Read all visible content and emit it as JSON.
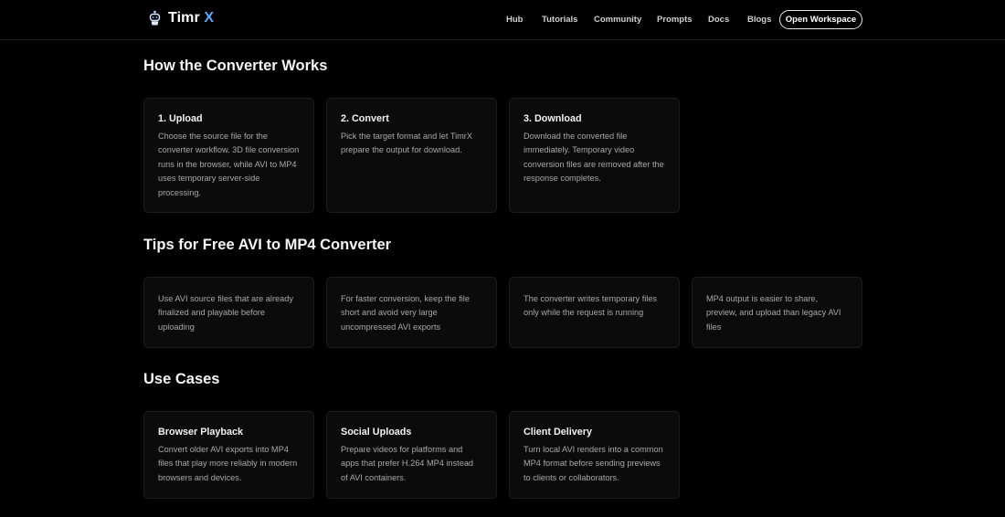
{
  "brand": {
    "name": "Timr",
    "accent": "X",
    "logo_icon": "robot-icon"
  },
  "nav": {
    "links": [
      "Hub",
      "Tutorials",
      "Community",
      "Prompts",
      "Docs",
      "Blogs"
    ],
    "cta": "Open Workspace"
  },
  "how": {
    "title": "How the Converter Works",
    "steps": [
      {
        "title": "1. Upload",
        "text": "Choose the source file for the converter workflow. 3D file conversion runs in the browser, while AVI to MP4 uses temporary server-side processing."
      },
      {
        "title": "2. Convert",
        "text": "Pick the target format and let TimrX prepare the output for download."
      },
      {
        "title": "3. Download",
        "text": "Download the converted file immediately. Temporary video conversion files are removed after the response completes."
      }
    ]
  },
  "tips": {
    "title": "Tips for Free AVI to MP4 Converter",
    "items": [
      "Use AVI source files that are already finalized and playable before uploading",
      "For faster conversion, keep the file short and avoid very large uncompressed AVI exports",
      "The converter writes temporary files only while the request is running",
      "MP4 output is easier to share, preview, and upload than legacy AVI files"
    ]
  },
  "use_cases": {
    "title": "Use Cases",
    "items": [
      {
        "title": "Browser Playback",
        "text": "Convert older AVI exports into MP4 files that play more reliably in modern browsers and devices."
      },
      {
        "title": "Social Uploads",
        "text": "Prepare videos for platforms and apps that prefer H.264 MP4 instead of AVI containers."
      },
      {
        "title": "Client Delivery",
        "text": "Turn local AVI renders into a common MP4 format before sending previews to clients or collaborators."
      }
    ]
  },
  "colors": {
    "background": "#000000",
    "card": "#0b0b0b",
    "accent": "#5aa8ff"
  }
}
